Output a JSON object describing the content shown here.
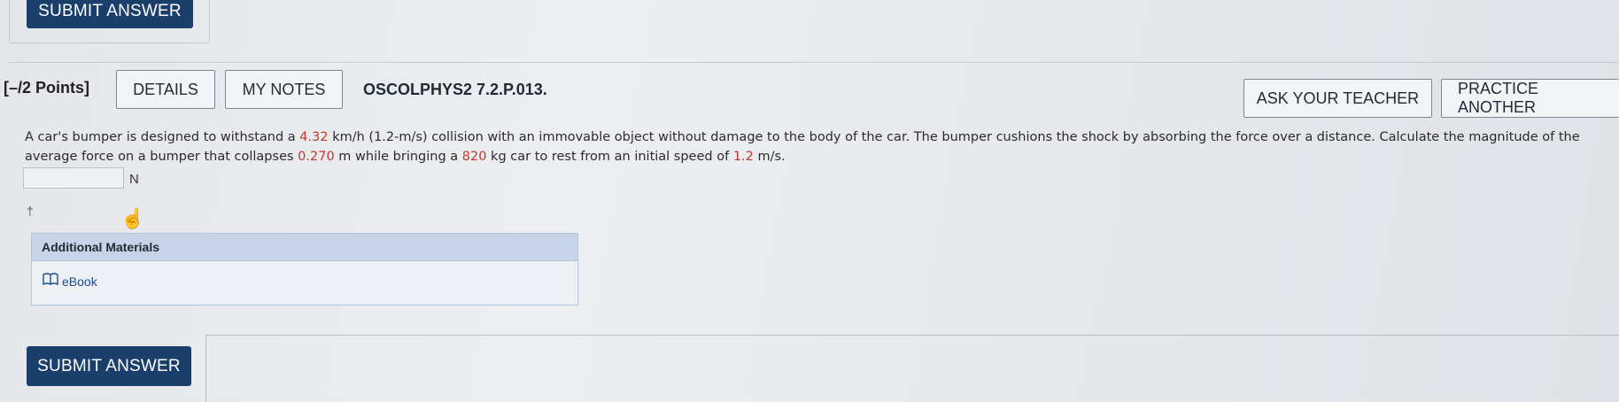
{
  "top_submit_label": "SUBMIT ANSWER",
  "question": {
    "points": "[–/2 Points]",
    "details_label": "DETAILS",
    "my_notes_label": "MY NOTES",
    "question_id": "OSCOLPHYS2 7.2.P.013.",
    "ask_teacher_label": "ASK YOUR TEACHER",
    "practice_another_label": "PRACTICE ANOTHER",
    "text_parts": [
      "A car's bumper is designed to withstand a ",
      "4.32",
      " km/h (1.2-m/s) collision with an immovable object without damage to the body of the car. The bumper cushions the shock by absorbing the force over a distance. Calculate the magnitude of the average force on a bumper that collapses ",
      "0.270",
      " m while bringing a ",
      "820",
      " kg car to rest from an initial speed of ",
      "1.2",
      " m/s."
    ],
    "answer_value": "",
    "answer_unit": "N",
    "dagger": "†"
  },
  "additional_materials": {
    "header": "Additional Materials",
    "ebook_label": "eBook"
  },
  "bottom_submit_label": "SUBMIT ANSWER",
  "colors": {
    "primary_button": "#1b3f6b",
    "highlight_value": "#c0392b",
    "materials_header": "#c6d3e8"
  },
  "icons": [
    "book-icon",
    "hand-cursor-icon"
  ]
}
